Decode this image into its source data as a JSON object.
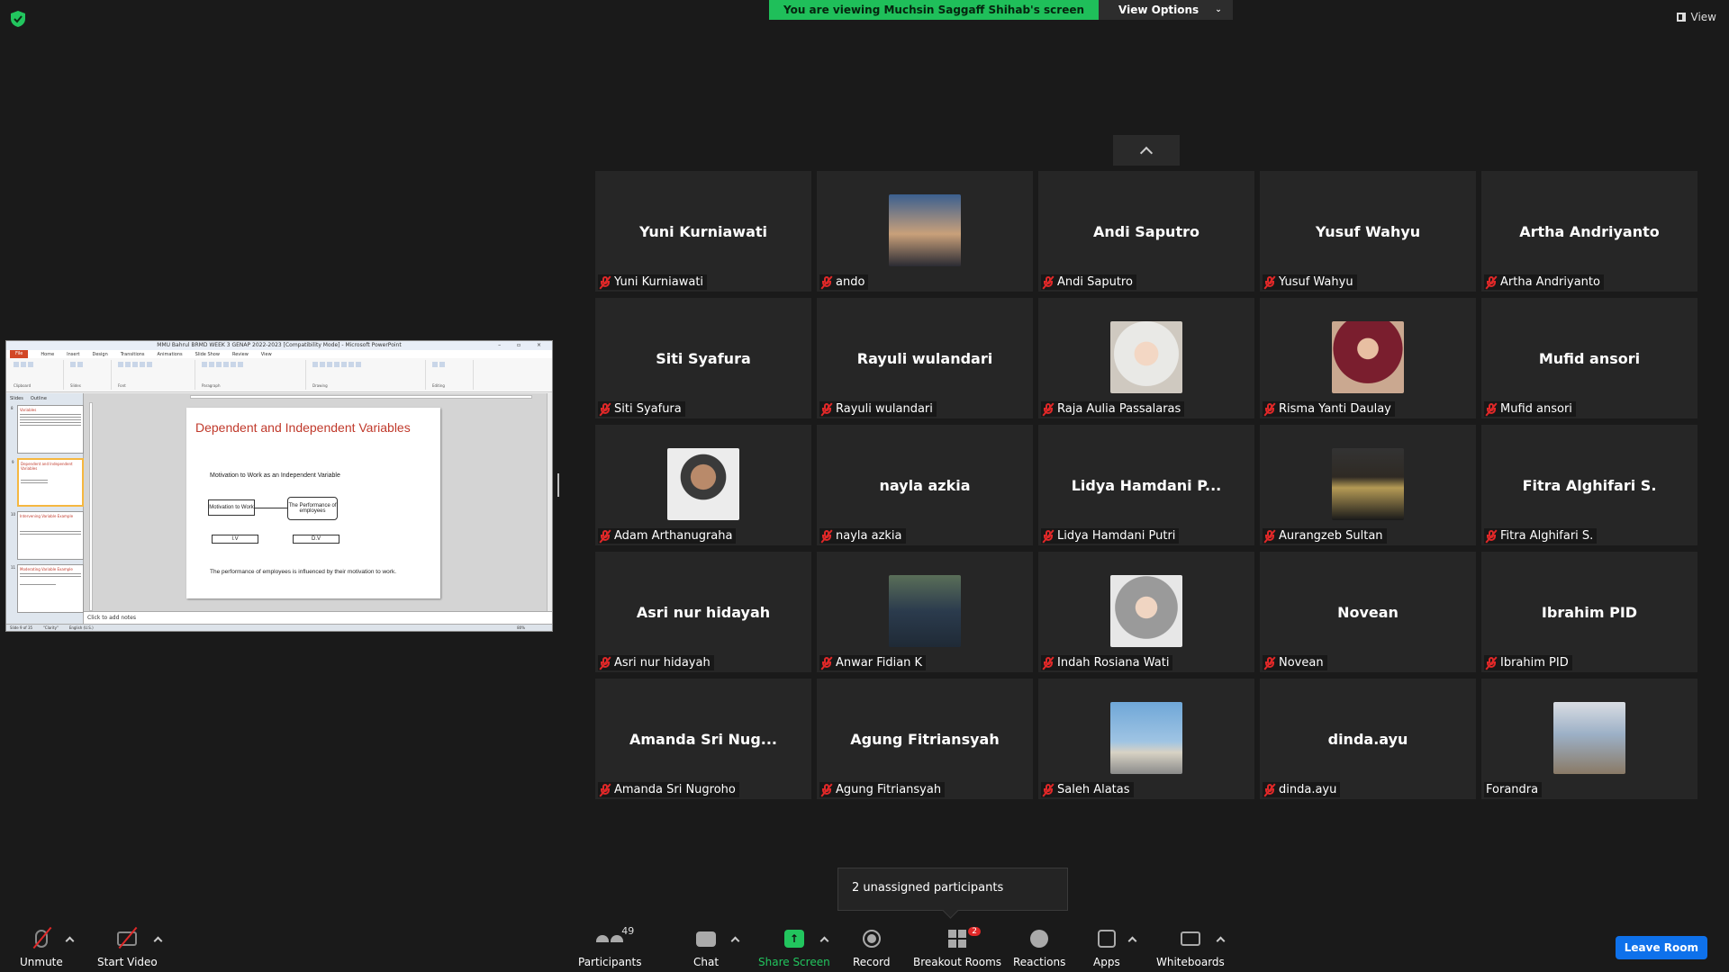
{
  "header": {
    "viewing_banner": "You are viewing Muchsin Saggaff Shihab's screen",
    "view_options": "View Options",
    "view_button": "View"
  },
  "shared_screen": {
    "window_title": "MMU Bahrul BRMD WEEK 3 GENAP 2022-2023 [Compatibility Mode] - Microsoft PowerPoint",
    "ribbon_tabs": [
      "File",
      "Home",
      "Insert",
      "Design",
      "Transitions",
      "Animations",
      "Slide Show",
      "Review",
      "View"
    ],
    "ribbon_groups": [
      "Clipboard",
      "Slides",
      "Font",
      "Paragraph",
      "Drawing",
      "Editing"
    ],
    "side_tabs": [
      "Slides",
      "Outline"
    ],
    "thumbnails": [
      {
        "num": "8",
        "title": "Variables"
      },
      {
        "num": "9",
        "title": "Dependent and Independent Variables"
      },
      {
        "num": "10",
        "title": "Intervening Variable Example"
      },
      {
        "num": "11",
        "title": "Moderating Variable Example"
      }
    ],
    "slide": {
      "title": "Dependent and Independent  Variables",
      "subtitle": "Motivation to Work as an Independent Variable",
      "box1": "Motivation to Work",
      "box2": "The Performance of employees",
      "label_iv": "I.V",
      "label_dv": "D.V",
      "footer": "The performance of employees is influenced by their motivation to work."
    },
    "notes": "Click to add notes",
    "status": [
      "Slide 9 of 35",
      "\"Clarity\"",
      "English (U.S.)",
      "80%"
    ]
  },
  "gallery": {
    "tiles": [
      {
        "name": "Yuni Kurniawati",
        "label": "Yuni Kurniawati",
        "muted": true,
        "photo": null
      },
      {
        "name": "",
        "label": "ando",
        "muted": true,
        "photo": "sunset"
      },
      {
        "name": "Andi Saputro",
        "label": "Andi Saputro",
        "muted": true,
        "photo": null
      },
      {
        "name": "Yusuf Wahyu",
        "label": "Yusuf Wahyu",
        "muted": true,
        "photo": null
      },
      {
        "name": "Artha Andriyanto",
        "label": "Artha Andriyanto",
        "muted": true,
        "photo": null
      },
      {
        "name": "Siti Syafura",
        "label": "Siti Syafura",
        "muted": true,
        "photo": null
      },
      {
        "name": "Rayuli wulandari",
        "label": "Rayuli wulandari",
        "muted": true,
        "photo": null
      },
      {
        "name": "",
        "label": "Raja Aulia Passalaras",
        "muted": true,
        "photo": "hijab-light"
      },
      {
        "name": "",
        "label": "Risma Yanti Daulay",
        "muted": true,
        "photo": "graduation"
      },
      {
        "name": "Mufid ansori",
        "label": "Mufid ansori",
        "muted": true,
        "photo": null
      },
      {
        "name": "",
        "label": "Adam Arthanugraha",
        "muted": true,
        "photo": "portrait-man"
      },
      {
        "name": "nayla azkia",
        "label": "nayla azkia",
        "muted": true,
        "photo": null
      },
      {
        "name": "Lidya Hamdani P...",
        "label": "Lidya Hamdani Putri",
        "muted": true,
        "photo": null
      },
      {
        "name": "",
        "label": "Aurangzeb Sultan",
        "muted": true,
        "photo": "night-sign"
      },
      {
        "name": "Fitra Alghifari S.",
        "label": "Fitra Alghifari S.",
        "muted": true,
        "photo": null
      },
      {
        "name": "Asri nur hidayah",
        "label": "Asri nur hidayah",
        "muted": true,
        "photo": null
      },
      {
        "name": "",
        "label": "Anwar Fidian K",
        "muted": true,
        "photo": "portrait-outdoor"
      },
      {
        "name": "",
        "label": "Indah Rosiana Wati",
        "muted": true,
        "photo": "hijab-grey"
      },
      {
        "name": "Novean",
        "label": "Novean",
        "muted": true,
        "photo": null
      },
      {
        "name": "Ibrahim PID",
        "label": "Ibrahim PID",
        "muted": true,
        "photo": null
      },
      {
        "name": "Amanda Sri Nug...",
        "label": "Amanda Sri Nugroho",
        "muted": true,
        "photo": null
      },
      {
        "name": "Agung Fitriansyah",
        "label": "Agung Fitriansyah",
        "muted": true,
        "photo": null
      },
      {
        "name": "",
        "label": "Saleh Alatas",
        "muted": true,
        "photo": "beach"
      },
      {
        "name": "dinda.ayu",
        "label": "dinda.ayu",
        "muted": true,
        "photo": null
      },
      {
        "name": "",
        "label": "Forandra",
        "muted": false,
        "photo": "room"
      }
    ]
  },
  "toast": {
    "text": "2 unassigned participants"
  },
  "toolbar": {
    "unmute": "Unmute",
    "start_video": "Start Video",
    "participants": "Participants",
    "participants_count": "49",
    "chat": "Chat",
    "share_screen": "Share Screen",
    "record": "Record",
    "breakout_rooms": "Breakout Rooms",
    "breakout_badge": "2",
    "reactions": "Reactions",
    "apps": "Apps",
    "whiteboards": "Whiteboards",
    "leave_room": "Leave Room"
  },
  "colors": {
    "share_green": "#1fbf5a",
    "mute_red": "#e02828",
    "leave_blue": "#0e71eb",
    "tile_bg": "#262626",
    "slide_title": "#c0392b"
  }
}
